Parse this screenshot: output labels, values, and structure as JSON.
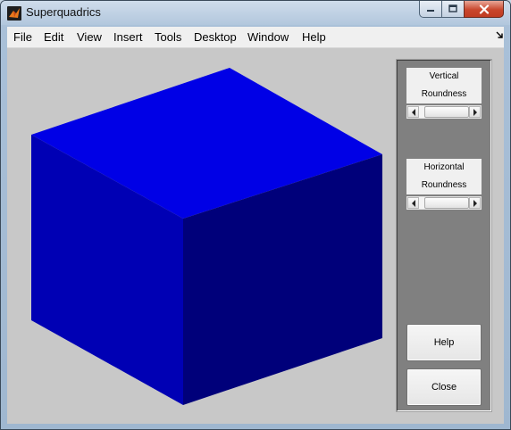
{
  "window": {
    "title": "Superquadrics"
  },
  "menubar": {
    "items": [
      "File",
      "Edit",
      "View",
      "Insert",
      "Tools",
      "Desktop",
      "Window",
      "Help"
    ],
    "dock_icon": "dock-arrow-icon"
  },
  "controls": {
    "vertical": {
      "label_line1": "Vertical",
      "label_line2": "Roundness"
    },
    "horizontal": {
      "label_line1": "Horizontal",
      "label_line2": "Roundness"
    },
    "help_label": "Help",
    "close_label": "Close"
  },
  "colors": {
    "cube_top": "#0000e6",
    "cube_front": "#0000b4",
    "cube_right": "#00007a",
    "figure_bg": "#c8c8c8",
    "panel_bg": "#808080"
  }
}
